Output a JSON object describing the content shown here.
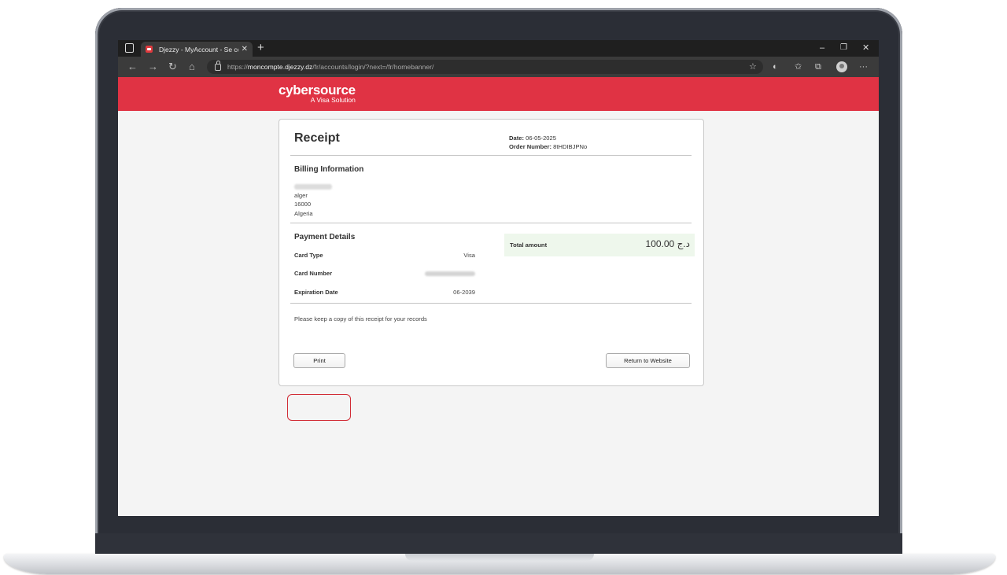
{
  "browser": {
    "tab_title": "Djezzy - MyAccount - Se connec",
    "tab_close": "✕",
    "new_tab": "+",
    "url_scheme": "https://",
    "url_host": "moncompte.djezzy.dz",
    "url_path": "/fr/accounts/login/?next=/fr/homebanner/",
    "icons": [
      "tab-actions-icon",
      "back-icon",
      "forward-icon",
      "refresh-icon",
      "home-icon",
      "lock-icon",
      "add-favorite-icon",
      "copilot-icon",
      "favorites-icon",
      "collections-icon",
      "profile-avatar",
      "more-icon"
    ],
    "window_controls": {
      "minimize": "–",
      "restore": "❐",
      "close": "✕"
    }
  },
  "header": {
    "brand": "cybersource",
    "tagline": "A Visa Solution",
    "brand_color": "#e03344"
  },
  "receipt": {
    "title": "Receipt",
    "date_label": "Date:",
    "date_value": "06-05-2025",
    "order_label": "Order Number:",
    "order_value": "8tHDIBJPNo",
    "billing": {
      "title": "Billing Information",
      "lines": [
        "alger",
        "16000",
        "Algeria"
      ]
    },
    "payment": {
      "title": "Payment Details",
      "rows": [
        {
          "label": "Card Type",
          "value": "Visa"
        },
        {
          "label": "Card Number",
          "value": ""
        },
        {
          "label": "Expiration Date",
          "value": "06-2039"
        }
      ]
    },
    "total": {
      "label": "Total amount",
      "value": "100.00 د.ج",
      "background": "#eef7ec"
    },
    "note": "Please keep a copy of this receipt for your records",
    "buttons": {
      "print": "Print",
      "return": "Return to Website"
    }
  },
  "annotation": {
    "highlight_color": "#d12d36"
  }
}
